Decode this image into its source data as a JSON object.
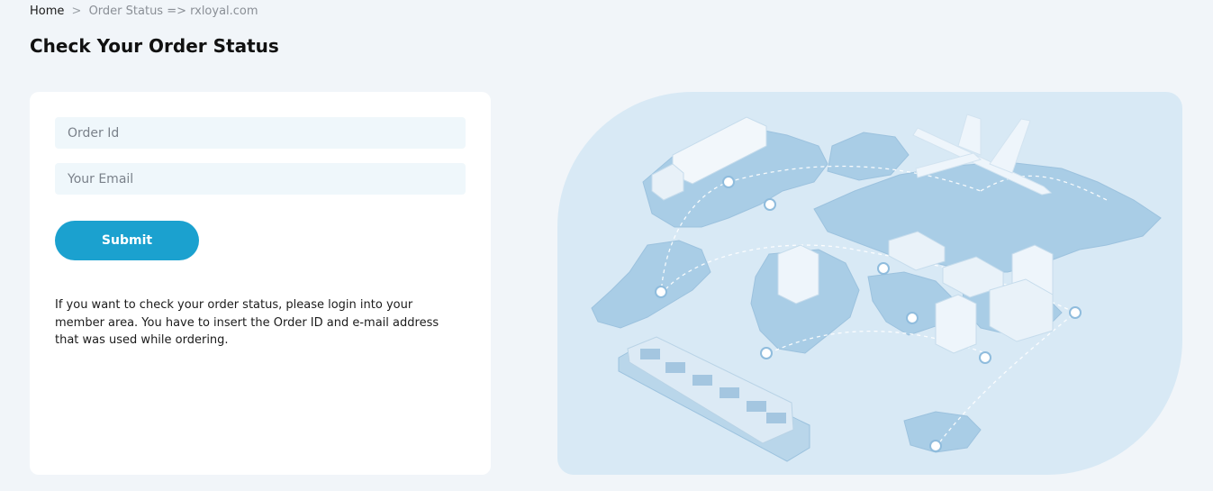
{
  "breadcrumb": {
    "home": "Home",
    "separator": ">",
    "current": "Order Status => rxloyal.com"
  },
  "page": {
    "title": "Check Your Order Status"
  },
  "form": {
    "order_id_placeholder": "Order Id",
    "email_placeholder": "Your Email",
    "submit_label": "Submit",
    "info_text": "If you want to check your order status, please login into your member area. You have to insert the Order ID and e-mail address that was used while ordering."
  },
  "colors": {
    "page_background": "#f1f5f9",
    "card_background": "#ffffff",
    "input_background": "#eff7fb",
    "accent": "#1ba1cf",
    "illustration_background": "#d8e9f5"
  },
  "illustration": {
    "icon": "world-logistics-map-illustration"
  }
}
